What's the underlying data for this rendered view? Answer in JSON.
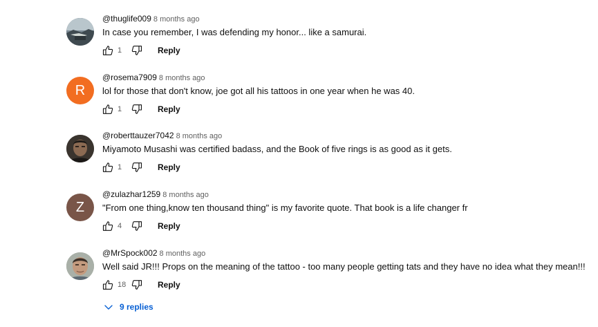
{
  "comments": [
    {
      "author": "@thuglife009",
      "time": "8 months ago",
      "text": "In case you remember, I was defending my honor... like a samurai.",
      "likes": "1",
      "reply_label": "Reply",
      "avatar": {
        "type": "image",
        "letter": "",
        "color": "#5a6770"
      }
    },
    {
      "author": "@rosema7909",
      "time": "8 months ago",
      "text": "lol  for those that don't know, joe got all his tattoos in one year when he was 40.",
      "likes": "1",
      "reply_label": "Reply",
      "avatar": {
        "type": "letter",
        "letter": "R",
        "color": "#f26d21"
      }
    },
    {
      "author": "@roberttauzer7042",
      "time": "8 months ago",
      "text": "Miyamoto Musashi was certified badass, and the Book of five rings is as good as it gets.",
      "likes": "1",
      "reply_label": "Reply",
      "avatar": {
        "type": "image",
        "letter": "",
        "color": "#2e2a26"
      }
    },
    {
      "author": "@zulazhar1259",
      "time": "8 months ago",
      "text": "\"From one thing,know ten thousand thing\" is my favorite quote. That book is a life changer fr",
      "likes": "4",
      "reply_label": "Reply",
      "avatar": {
        "type": "letter",
        "letter": "Z",
        "color": "#795548"
      }
    },
    {
      "author": "@MrSpock002",
      "time": "8 months ago",
      "text": "Well said JR!!!  Props on the meaning of the tattoo - too many people getting tats and they have no idea what they mean!!!",
      "likes": "18",
      "reply_label": "Reply",
      "avatar": {
        "type": "image",
        "letter": "",
        "color": "#8a8f86"
      }
    }
  ],
  "replies_toggle": {
    "label": "9 replies",
    "color": "#065fd4"
  },
  "icons": {
    "like": "thumbs-up-icon",
    "dislike": "thumbs-down-icon",
    "expand": "chevron-down-icon"
  }
}
